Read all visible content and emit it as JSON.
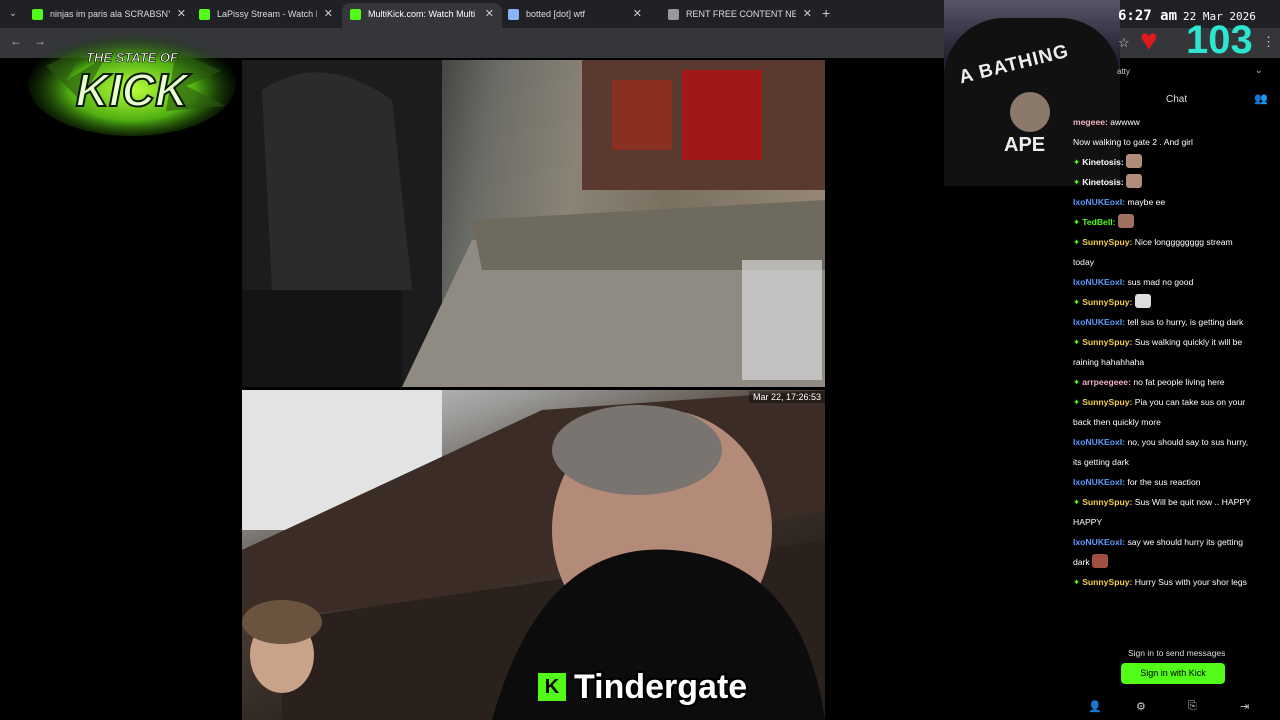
{
  "browser": {
    "tabs": [
      {
        "title": "ninjas im paris ala SCRABSNYC",
        "icon_color": "#53fc18",
        "active": false
      },
      {
        "title": "LaPissy Stream - Watch Live on",
        "icon_color": "#53fc18",
        "active": false
      },
      {
        "title": "MultiKick.com: Watch Multi",
        "icon_color": "#53fc18",
        "active": true
      },
      {
        "title": "botted [dot] wtf",
        "icon_color": "#8ab4f8",
        "active": false
      },
      {
        "title": "RENT FREE CONTENT NETWOR",
        "icon_color": "#999999",
        "active": false
      }
    ],
    "close_glyph": "✕",
    "new_tab_glyph": "+",
    "back_glyph": "←",
    "forward_glyph": "→"
  },
  "logo": {
    "line1": "THE STATE OF",
    "line2": "KICK"
  },
  "video_top": {},
  "video_bottom": {
    "timestamp": "Mar 22, 17:26:53"
  },
  "caption": {
    "icon": "K",
    "text": "Tindergate"
  },
  "webcam": {
    "shirt_line1": "A BATHING",
    "shirt_line2": "APE"
  },
  "overlay": {
    "clock": "6:27 am",
    "date": "22 Mar 2026",
    "viewer_count": "103",
    "heart_glyph": "♥",
    "star_glyph": "☆",
    "menu_glyph": "⋮"
  },
  "chat": {
    "title": "Chat",
    "dropdown_glyph": "⌄",
    "users_icon_glyph": "👥",
    "partial_user": "atty",
    "messages": [
      {
        "user": "megeee",
        "color": "#f5b0c0",
        "text": "awwww",
        "badge": false,
        "emote": null
      },
      {
        "user": "",
        "color": "#ffffff",
        "text": "Now walking to gate 2 . And girl",
        "badge": false,
        "emote": null
      },
      {
        "user": "Kinetosis",
        "color": "#ffffff",
        "text": "",
        "badge": true,
        "emote": "#b08c7a"
      },
      {
        "user": "Kinetosis",
        "color": "#ffffff",
        "text": "",
        "badge": true,
        "emote": "#b08c7a"
      },
      {
        "user": "IxoNUKEoxI",
        "color": "#5b9bff",
        "text": "maybe ee",
        "badge": false,
        "emote": null
      },
      {
        "user": "TedBell",
        "color": "#53fc18",
        "text": "",
        "badge": true,
        "emote": "#a07060"
      },
      {
        "user": "SunnySpuy",
        "color": "#f2d04a",
        "text": "Nice longggggggg stream",
        "badge": true,
        "emote": null
      },
      {
        "user": "",
        "color": "#ffffff",
        "text": "today",
        "badge": false,
        "emote": null
      },
      {
        "user": "IxoNUKEoxI",
        "color": "#5b9bff",
        "text": "sus mad no good",
        "badge": false,
        "emote": null
      },
      {
        "user": "SunnySpuy",
        "color": "#f2d04a",
        "text": "",
        "badge": true,
        "emote": "#dddddd"
      },
      {
        "user": "IxoNUKEoxI",
        "color": "#5b9bff",
        "text": "tell sus to hurry, is getting dark",
        "badge": false,
        "emote": null
      },
      {
        "user": "SunnySpuy",
        "color": "#f2d04a",
        "text": "Sus walking quickly it will be",
        "badge": true,
        "emote": null
      },
      {
        "user": "",
        "color": "#ffffff",
        "text": "raining hahahhaha",
        "badge": false,
        "emote": null
      },
      {
        "user": "arrpeegeee",
        "color": "#f5b0c0",
        "text": "no fat people living here",
        "badge": true,
        "emote": null
      },
      {
        "user": "SunnySpuy",
        "color": "#f2d04a",
        "text": "Pia you can take sus on your",
        "badge": true,
        "emote": null
      },
      {
        "user": "",
        "color": "#ffffff",
        "text": "back then quickly more",
        "badge": false,
        "emote": null
      },
      {
        "user": "IxoNUKEoxI",
        "color": "#5b9bff",
        "text": "no, you should say to sus hurry,",
        "badge": false,
        "emote": null
      },
      {
        "user": "",
        "color": "#ffffff",
        "text": "its getting dark",
        "badge": false,
        "emote": null
      },
      {
        "user": "IxoNUKEoxI",
        "color": "#5b9bff",
        "text": "for the sus reaction",
        "badge": false,
        "emote": null
      },
      {
        "user": "SunnySpuy",
        "color": "#f2d04a",
        "text": "Sus Will be quit now .. HAPPY",
        "badge": true,
        "emote": null
      },
      {
        "user": "",
        "color": "#ffffff",
        "text": "HAPPY",
        "badge": false,
        "emote": null
      },
      {
        "user": "IxoNUKEoxI",
        "color": "#5b9bff",
        "text": "say we should hurry its getting",
        "badge": false,
        "emote": null
      },
      {
        "user": "",
        "color": "#ffffff",
        "text": "dark",
        "badge": false,
        "emote": "#a05040"
      },
      {
        "user": "SunnySpuy",
        "color": "#f2d04a",
        "text": "Hurry Sus with your shor legs",
        "badge": true,
        "emote": null
      }
    ],
    "signin_prompt": "Sign in to send messages",
    "signin_button": "Sign in with Kick",
    "footer_icons": [
      {
        "name": "add-user-icon",
        "glyph": "👤"
      },
      {
        "name": "settings-icon",
        "glyph": "⚙"
      },
      {
        "name": "popout-icon",
        "glyph": "⎘"
      },
      {
        "name": "exit-icon",
        "glyph": "⇥"
      }
    ]
  },
  "colors": {
    "kick_green": "#53fc18",
    "heart_red": "#e0191d",
    "counter_teal": "#2ee6d0"
  }
}
